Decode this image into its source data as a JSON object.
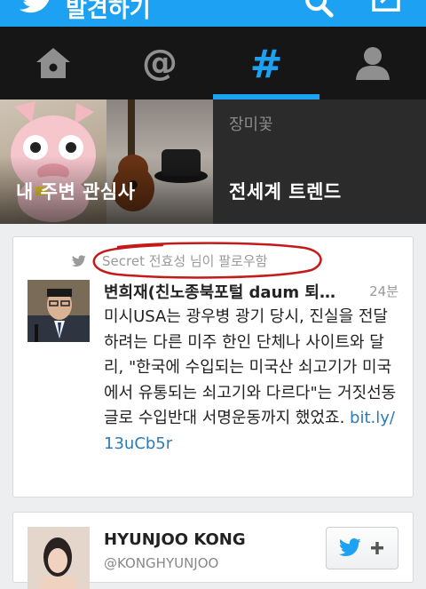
{
  "app": {
    "title": "발견하기",
    "accent_color": "#1da1f2",
    "icons": [
      "twitter-bird-icon",
      "search-icon",
      "compose-icon"
    ]
  },
  "tabs": [
    {
      "name": "home",
      "icon": "home-icon",
      "active": false
    },
    {
      "name": "connect",
      "icon": "at-icon",
      "active": false
    },
    {
      "name": "discover",
      "icon": "hashtag-icon",
      "active": true
    },
    {
      "name": "me",
      "icon": "person-icon",
      "active": false
    }
  ],
  "discover": {
    "left_tile": {
      "label": "내 주변 관심사"
    },
    "right_tile": {
      "label": "전세계 트렌드",
      "sub": "장미꽃"
    }
  },
  "timeline": [
    {
      "context": "Secret 전효성  님이 팔로우함",
      "author": "변희재(친노종북포털 daum 퇴…",
      "time": "24분",
      "text": "미시USA는 광우병 광기 당시, 진실을 전달하려는 다른 미주 한인 단체나 사이트와 달리, \"한국에 수입되는 미국산 쇠고기가 미국에서 유통되는 쇠고기와 다르다\"는 거짓선동 글로 수입반대 서명운동까지 했었죠. ",
      "link": "bit.ly/13uCb5r"
    },
    {
      "author": "HYUNJOO KONG",
      "handle": "@KONGHYUNJOO",
      "follow_icon": "follow-bird-plus-icon"
    }
  ]
}
